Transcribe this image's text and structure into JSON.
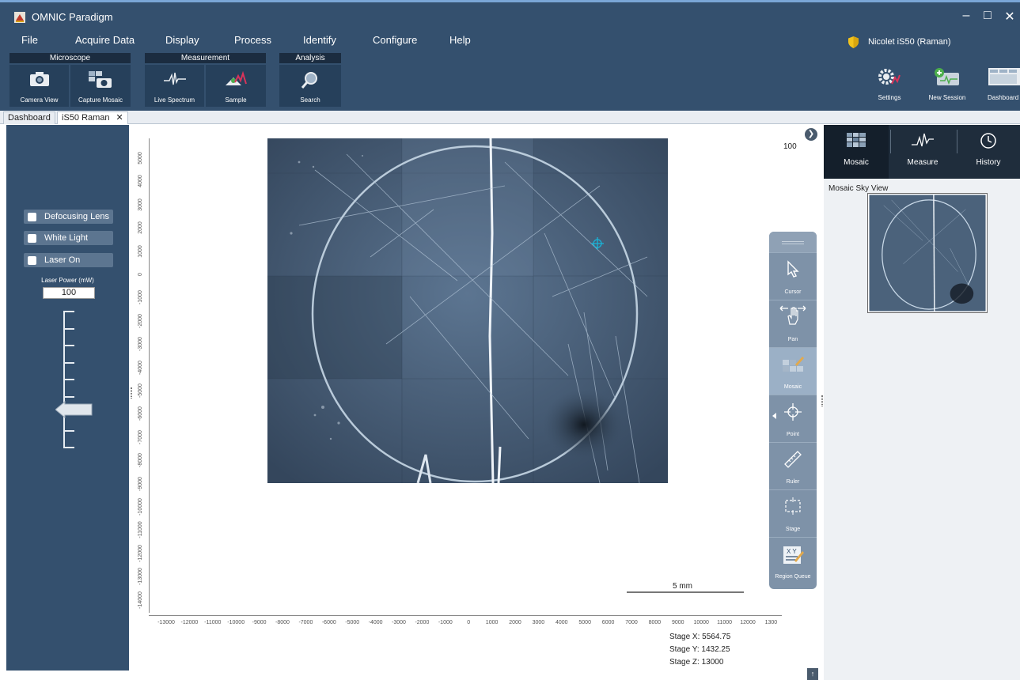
{
  "window": {
    "title": "OMNIC Paradigm",
    "minimize": "–",
    "maximize": "□",
    "close": "✕"
  },
  "menu": [
    "File",
    "Acquire Data",
    "Display",
    "Process",
    "Identify",
    "Configure",
    "Help"
  ],
  "instrument": "Nicolet iS50 (Raman)",
  "ribbon": {
    "microscope": {
      "label": "Microscope",
      "camera_view": "Camera View",
      "capture_mosaic": "Capture Mosaic"
    },
    "measurement": {
      "label": "Measurement",
      "live_spectrum": "Live Spectrum",
      "sample": "Sample"
    },
    "analysis": {
      "label": "Analysis",
      "search": "Search"
    },
    "settings": "Settings",
    "new_session": "New Session",
    "dashboard": "Dashboard"
  },
  "tabs": {
    "dashboard": "Dashboard",
    "session": "iS50 Raman",
    "close": "✕"
  },
  "left_panel": {
    "defocusing_lens": "Defocusing Lens",
    "white_light": "White Light",
    "laser_on": "Laser On",
    "laser_power_label": "Laser Power (mW)",
    "laser_power_value": "100",
    "laser_power_slider_fraction": 0.72
  },
  "viewer": {
    "zoom": "100",
    "scale_bar": "5 mm",
    "y_ticks": [
      "5000",
      "4000",
      "3000",
      "2000",
      "1000",
      "0",
      "-1000",
      "-2000",
      "-3000",
      "-4000",
      "-5000",
      "-6000",
      "-7000",
      "-8000",
      "-9000",
      "-10000",
      "-11000",
      "-12000",
      "-13000",
      "-14000"
    ],
    "x_ticks": [
      "-13000",
      "-12000",
      "-11000",
      "-10000",
      "-9000",
      "-8000",
      "-7000",
      "-6000",
      "-5000",
      "-4000",
      "-3000",
      "-2000",
      "-1000",
      "0",
      "1000",
      "2000",
      "3000",
      "4000",
      "5000",
      "6000",
      "7000",
      "8000",
      "9000",
      "10000",
      "11000",
      "12000",
      "1300"
    ],
    "stage_x": "Stage X: 5564.75",
    "stage_y": "Stage Y: 1432.25",
    "stage_z": "Stage Z: 13000"
  },
  "tools": {
    "cursor": "Cursor",
    "pan": "Pan",
    "mosaic": "Mosaic",
    "point": "Point",
    "ruler": "Ruler",
    "stage": "Stage",
    "region_queue": "Region Queue"
  },
  "right_panel": {
    "tabs": {
      "mosaic": "Mosaic",
      "measure": "Measure",
      "history": "History"
    },
    "sky_view_title": "Mosaic Sky View"
  },
  "colors": {
    "chrome": "#34506e",
    "ribbon_button": "#26405b",
    "panel_dark": "#1f2d3c",
    "accent": "#7aa6d6",
    "target": "#19b4d8"
  },
  "icons": [
    "camera-icon",
    "mosaic-camera-icon",
    "spectrum-icon",
    "sample-icon",
    "search-icon",
    "settings-icon",
    "new-session-icon",
    "dashboard-icon",
    "cursor-icon",
    "pan-icon",
    "mosaic-icon",
    "point-icon",
    "ruler-icon",
    "stage-icon",
    "region-queue-icon",
    "history-icon",
    "shield-icon"
  ]
}
